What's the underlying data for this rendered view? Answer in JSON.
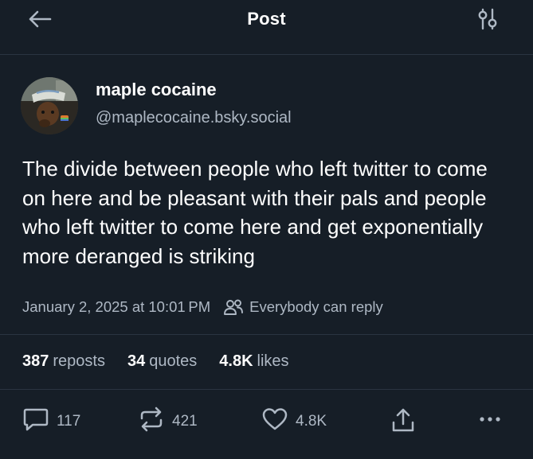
{
  "header": {
    "title": "Post",
    "back_icon": "arrow-left-icon",
    "filter_icon": "sliders-icon"
  },
  "author": {
    "display_name": "maple cocaine",
    "handle": "@maplecocaine.bsky.social"
  },
  "post": {
    "text": "The divide between people who left twitter to come on here and be pleasant with their pals and people who left twitter to come here and get exponentially more deranged is striking",
    "timestamp": "January 2, 2025 at 10:01 PM",
    "reply_setting": "Everybody can reply"
  },
  "stats": {
    "reposts_count": "387",
    "reposts_label": "reposts",
    "quotes_count": "34",
    "quotes_label": "quotes",
    "likes_count": "4.8K",
    "likes_label": "likes"
  },
  "actions": {
    "reply_count": "117",
    "repost_count": "421",
    "like_count": "4.8K"
  },
  "colors": {
    "background": "#161e27",
    "text_primary": "#ffffff",
    "text_secondary": "#aeb8c4",
    "divider": "#2a3441"
  }
}
